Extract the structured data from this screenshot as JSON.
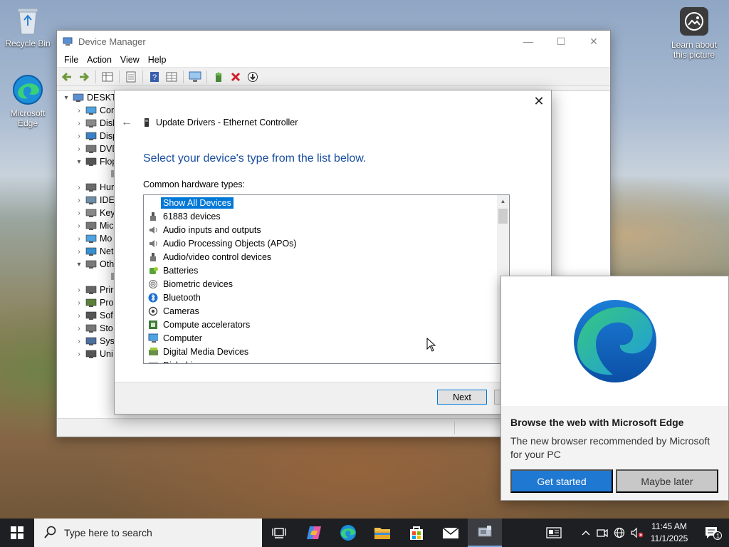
{
  "desktop": {
    "icons": [
      {
        "label": "Recycle Bin"
      },
      {
        "label": "Microsoft Edge"
      }
    ],
    "learn_about": "Learn about this picture"
  },
  "device_manager": {
    "title": "Device Manager",
    "menu": [
      "File",
      "Action",
      "View",
      "Help"
    ],
    "controls": {
      "minimize": "—",
      "maximize": "☐",
      "close": "✕"
    },
    "tree": [
      {
        "label": "DESKTO",
        "arrow": "▾",
        "icon": "computer-icon"
      },
      {
        "label": "Cor",
        "arrow": "›",
        "icon": "monitor-icon"
      },
      {
        "label": "Disl",
        "arrow": "›",
        "icon": "disk-icon"
      },
      {
        "label": "Disp",
        "arrow": "›",
        "icon": "display-icon"
      },
      {
        "label": "DVD",
        "arrow": "›",
        "icon": "dvd-icon"
      },
      {
        "label": "Flop",
        "arrow": "▾",
        "icon": "floppy-icon"
      },
      {
        "label": "",
        "arrow": "",
        "icon": "warning-device-icon"
      },
      {
        "label": "Hur",
        "arrow": "›",
        "icon": "hid-icon"
      },
      {
        "label": "IDE",
        "arrow": "›",
        "icon": "ide-icon"
      },
      {
        "label": "Key",
        "arrow": "›",
        "icon": "keyboard-icon"
      },
      {
        "label": "Mic",
        "arrow": "›",
        "icon": "mouse-icon"
      },
      {
        "label": "Mo",
        "arrow": "›",
        "icon": "monitor-icon"
      },
      {
        "label": "Net",
        "arrow": "›",
        "icon": "network-icon"
      },
      {
        "label": "Oth",
        "arrow": "▾",
        "icon": "other-devices-icon"
      },
      {
        "label": "",
        "arrow": "",
        "icon": "warning-device-icon"
      },
      {
        "label": "Prir",
        "arrow": "›",
        "icon": "printer-icon"
      },
      {
        "label": "Pro",
        "arrow": "›",
        "icon": "processor-icon"
      },
      {
        "label": "Sof",
        "arrow": "›",
        "icon": "software-icon"
      },
      {
        "label": "Sto",
        "arrow": "›",
        "icon": "storage-icon"
      },
      {
        "label": "Sys",
        "arrow": "›",
        "icon": "system-icon"
      },
      {
        "label": "Uni",
        "arrow": "›",
        "icon": "usb-icon"
      }
    ]
  },
  "wizard": {
    "header": "Update Drivers - Ethernet Controller",
    "heading": "Select your device's type from the list below.",
    "list_label": "Common hardware types:",
    "items": [
      {
        "label": "Show All Devices",
        "icon": "",
        "selected": true
      },
      {
        "label": "61883 devices",
        "icon": "plug-icon"
      },
      {
        "label": "Audio inputs and outputs",
        "icon": "speaker-icon"
      },
      {
        "label": "Audio Processing Objects (APOs)",
        "icon": "speaker-icon"
      },
      {
        "label": "Audio/video control devices",
        "icon": "plug-icon"
      },
      {
        "label": "Batteries",
        "icon": "battery-icon"
      },
      {
        "label": "Biometric devices",
        "icon": "fingerprint-icon"
      },
      {
        "label": "Bluetooth",
        "icon": "bluetooth-icon"
      },
      {
        "label": "Cameras",
        "icon": "camera-icon"
      },
      {
        "label": "Compute accelerators",
        "icon": "chip-icon"
      },
      {
        "label": "Computer",
        "icon": "computer-icon"
      },
      {
        "label": "Digital Media Devices",
        "icon": "media-device-icon"
      },
      {
        "label": "Disk drives",
        "icon": "disk-icon"
      }
    ],
    "next_button": "Next",
    "close": "✕",
    "back": "←"
  },
  "edge_popup": {
    "title": "Browse the web with Microsoft Edge",
    "subtitle": "The new browser recommended by Microsoft for your PC",
    "primary_button": "Get started",
    "secondary_button": "Maybe later"
  },
  "taskbar": {
    "search_placeholder": "Type here to search",
    "time": "11:45 AM",
    "date": "11/1/2025",
    "notification_count": "1"
  },
  "colors": {
    "accent": "#0078d7",
    "heading_blue": "#1a4fa0",
    "edge_button": "#1f78d1"
  }
}
